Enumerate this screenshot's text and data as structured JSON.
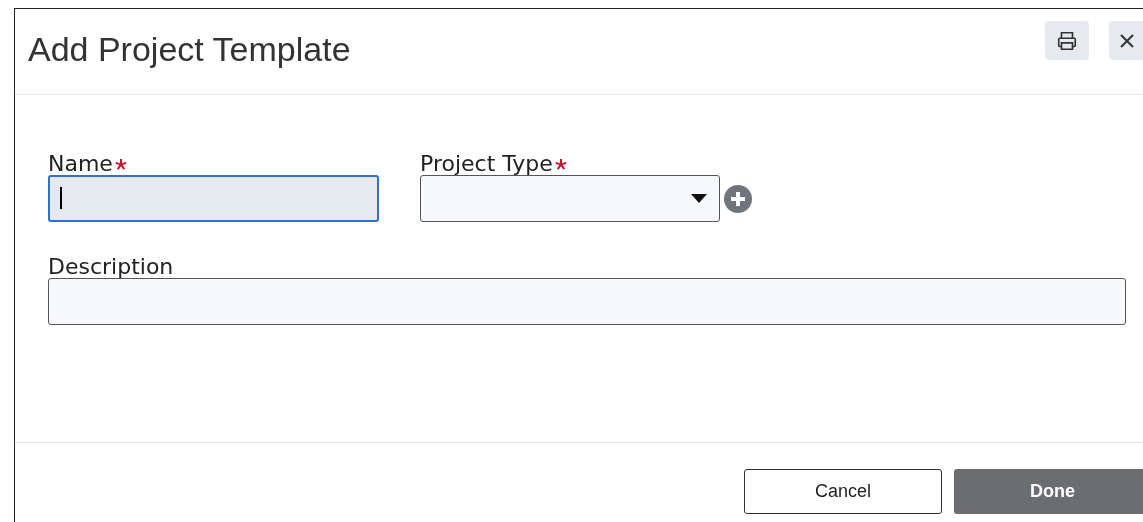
{
  "window": {
    "title": "Add Project Template"
  },
  "fields": [
    {
      "kind": "text",
      "label": "Name",
      "required": true,
      "focused": true
    },
    {
      "kind": "select",
      "label": "Project Type",
      "required": true,
      "focused": false
    },
    {
      "kind": "text",
      "label": "Description",
      "required": false,
      "focused": false
    }
  ],
  "buttons": [
    {
      "label": "Cancel",
      "kind": "secondary"
    },
    {
      "label": "Done",
      "kind": "primary"
    }
  ]
}
